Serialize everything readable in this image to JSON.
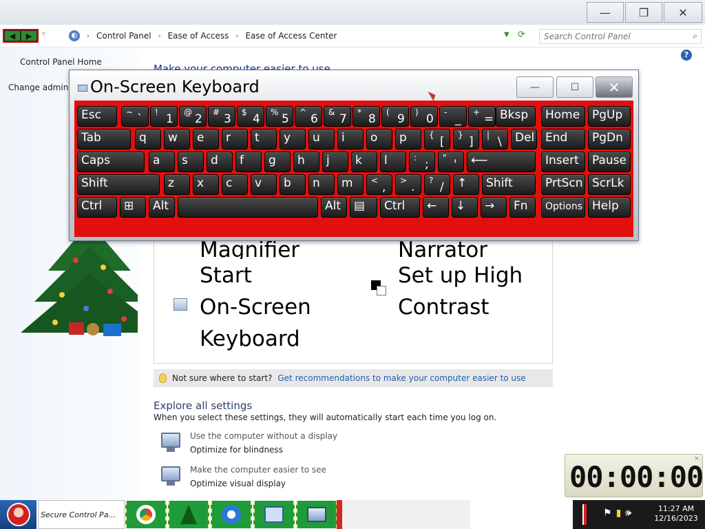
{
  "window": {
    "minimize_glyph": "—",
    "restore_glyph": "❐",
    "close_glyph": "✕"
  },
  "address": {
    "crumbs": [
      "Control Panel",
      "Ease of Access",
      "Ease of Access Center"
    ],
    "search_placeholder": "Search Control Panel"
  },
  "left_pane": {
    "home": "Control Panel Home",
    "change": "Change administrative settings"
  },
  "main": {
    "title": "Make your computer easier to use",
    "tools": {
      "magnifier": "Magnifier",
      "narrator": "Narrator",
      "osk_line1": "Start",
      "osk_line2": "On-Screen",
      "osk_line3": "Keyboard",
      "hc_line1": "Set up High",
      "hc_line2": "Contrast"
    },
    "tip": {
      "question": "Not sure where to start?",
      "link": "Get recommendations to make your computer easier to use"
    },
    "explore": {
      "title": "Explore all settings",
      "subtitle": "When you select these settings, they will automatically start each time you log on.",
      "items": [
        {
          "line1": "Use the computer without a display",
          "line2": "Optimize for blindness"
        },
        {
          "line1": "Make the computer easier to see",
          "line2": "Optimize visual display"
        }
      ]
    }
  },
  "osk": {
    "title": "On-Screen Keyboard",
    "body_color": "#e30e0e",
    "rows": [
      [
        "Esc",
        "~ `",
        "! 1",
        "@ 2",
        "# 3",
        "$ 4",
        "% 5",
        "^ 6",
        "& 7",
        "* 8",
        "( 9",
        ") 0",
        "- _",
        "+ =",
        "Bksp",
        "Home",
        "PgUp"
      ],
      [
        "Tab",
        "q",
        "w",
        "e",
        "r",
        "t",
        "y",
        "u",
        "i",
        "o",
        "p",
        "{ [",
        "} ]",
        "| \\",
        "Del",
        "End",
        "PgDn"
      ],
      [
        "Caps",
        "a",
        "s",
        "d",
        "f",
        "g",
        "h",
        "j",
        "k",
        "l",
        ": ;",
        "\" '",
        "⟵",
        "Insert",
        "Pause"
      ],
      [
        "Shift",
        "z",
        "x",
        "c",
        "v",
        "b",
        "n",
        "m",
        "< ,",
        "> .",
        "? /",
        "↑",
        "Shift",
        "PrtScn",
        "ScrLk"
      ],
      [
        "Ctrl",
        "⊞",
        "Alt",
        "",
        "Alt",
        "▤",
        "Ctrl",
        "←",
        "↓",
        "→",
        "Fn",
        "Options",
        "Help"
      ]
    ]
  },
  "timer": {
    "display": "00:00:00"
  },
  "taskbar": {
    "cp_label": "Secure Control Pa...",
    "time": "11:27 AM",
    "date": "12/16/2023"
  }
}
